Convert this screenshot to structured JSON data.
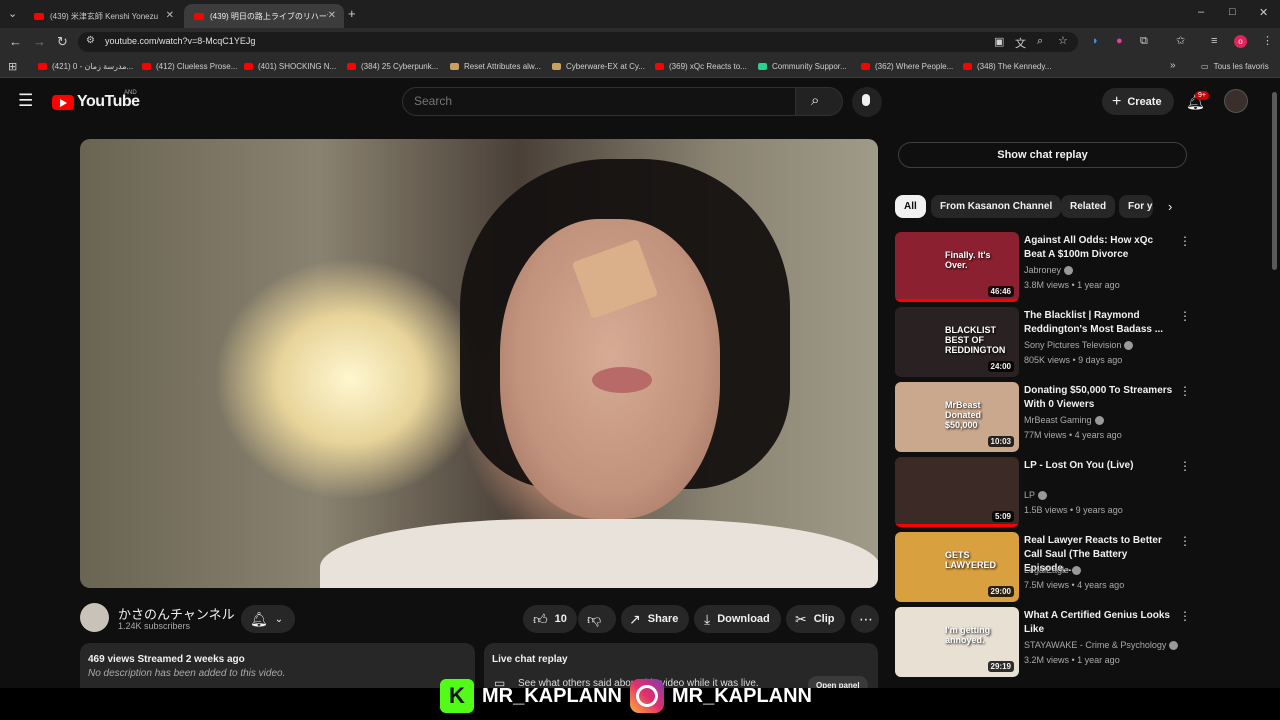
{
  "browser": {
    "tabs": [
      {
        "title": "(439) 米津玄師 Kenshi Yonezu"
      },
      {
        "title": "(439) 明日の路上ライブのリハーサル"
      }
    ],
    "url": "youtube.com/watch?v=8-McqC1YEJg",
    "bookmarks": [
      "(421) مدرسة زمان - 0...",
      "(412) Clueless Prose...",
      "(401) SHOCKING N...",
      "(384) 25 Cyberpunk...",
      "Reset Attributes alw...",
      "Cyberware-EX at Cy...",
      "(369) xQc Reacts to...",
      "Community Suppor...",
      "(362) Where People...",
      "(348) The Kennedy..."
    ],
    "all_bookmarks": "Tous les favoris"
  },
  "header": {
    "logo_text": "YouTube",
    "region": "AND",
    "search_placeholder": "Search",
    "create_label": "Create",
    "notifications": "9+"
  },
  "video": {
    "channel_name": "かさのんチャンネル",
    "subscribers": "1.24K subscribers",
    "likes": "10",
    "share_label": "Share",
    "download_label": "Download",
    "clip_label": "Clip",
    "views_date": "469 views  Streamed 2 weeks ago",
    "description": "No description has been added to this video.",
    "live_chat_title": "Live chat replay",
    "live_chat_sub": "See what others said about this video while it was live.",
    "open_panel": "Open panel"
  },
  "sidebar": {
    "chat_replay": "Show chat replay",
    "chips": [
      "All",
      "From Kasanon Channel",
      "Related",
      "For y"
    ],
    "recommendations": [
      {
        "title": "Against All Odds: How xQc Beat A $100m Divorce",
        "channel": "Jabroney",
        "meta": "3.8M views • 1 year ago",
        "duration": "46:46",
        "thumb_text": "Finally. It's Over.",
        "bg": "#8a2030",
        "progress": 100
      },
      {
        "title": "The Blacklist | Raymond Reddington's Most Badass ...",
        "channel": "Sony Pictures Television",
        "meta": "805K views • 9 days ago",
        "duration": "24:00",
        "thumb_text": "BLACKLIST BEST OF REDDINGTON",
        "bg": "#2a2222",
        "progress": 0
      },
      {
        "title": "Donating $50,000 To Streamers With 0 Viewers",
        "channel": "MrBeast Gaming",
        "meta": "77M views • 4 years ago",
        "duration": "10:03",
        "thumb_text": "MrBeast Donated $50,000",
        "bg": "#c9a88e",
        "progress": 0
      },
      {
        "title": "LP - Lost On You (Live)",
        "channel": "LP",
        "meta": "1.5B views • 9 years ago",
        "duration": "5:09",
        "thumb_text": "",
        "bg": "#3b2a26",
        "progress": 100
      },
      {
        "title": "Real Lawyer Reacts to Better Call Saul (The Battery Episode,...",
        "channel": "LegalEagle",
        "meta": "7.5M views • 4 years ago",
        "duration": "29:00",
        "thumb_text": "GETS LAWYERED",
        "bg": "#d9a040",
        "progress": 0
      },
      {
        "title": "What A Certified Genius Looks Like",
        "channel": "STAYAWAKE - Crime & Psychology",
        "meta": "3.2M views • 1 year ago",
        "duration": "29:19",
        "thumb_text": "I'm getting annoyed.",
        "bg": "#e8e0d2",
        "progress": 0
      }
    ]
  },
  "watermark": {
    "handle_1": "MR_KAPLANN",
    "handle_2": "MR_KAPLANN",
    "kick_letter": "K"
  }
}
